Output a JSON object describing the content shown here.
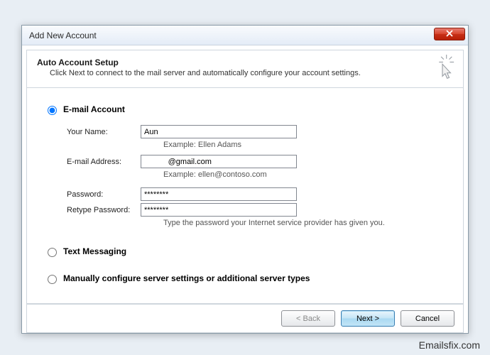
{
  "window": {
    "title": "Add New Account"
  },
  "header": {
    "title": "Auto Account Setup",
    "subtitle": "Click Next to connect to the mail server and automatically configure your account settings."
  },
  "options": {
    "email_account": "E-mail Account",
    "text_messaging": "Text Messaging",
    "manual": "Manually configure server settings or additional server types"
  },
  "form": {
    "name_label": "Your Name:",
    "name_value": "Aun",
    "name_hint": "Example: Ellen Adams",
    "email_label": "E-mail Address:",
    "email_value": "           @gmail.com",
    "email_hint": "Example: ellen@contoso.com",
    "password_label": "Password:",
    "password_value": "********",
    "retype_label": "Retype Password:",
    "retype_value": "********",
    "password_hint": "Type the password your Internet service provider has given you."
  },
  "buttons": {
    "back": "< Back",
    "next": "Next >",
    "cancel": "Cancel"
  },
  "watermark": "Emailsfix.com"
}
